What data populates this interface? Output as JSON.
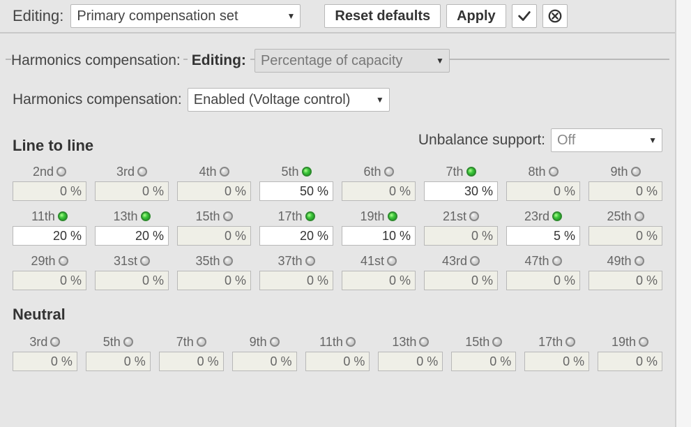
{
  "topbar": {
    "editing_label": "Editing:",
    "set_select": "Primary compensation set",
    "reset": "Reset defaults",
    "apply": "Apply"
  },
  "fieldset": {
    "title": "Harmonics compensation:",
    "editing_label": "Editing:",
    "editing_select": "Percentage of capacity"
  },
  "harm_comp": {
    "label": "Harmonics compensation:",
    "value": "Enabled (Voltage control)"
  },
  "line_to_line": {
    "title": "Line to line",
    "unbalance_label": "Unbalance support:",
    "unbalance_value": "Off",
    "items": [
      {
        "label": "2nd",
        "on": false,
        "value": "0 %"
      },
      {
        "label": "3rd",
        "on": false,
        "value": "0 %"
      },
      {
        "label": "4th",
        "on": false,
        "value": "0 %"
      },
      {
        "label": "5th",
        "on": true,
        "value": "50 %"
      },
      {
        "label": "6th",
        "on": false,
        "value": "0 %"
      },
      {
        "label": "7th",
        "on": true,
        "value": "30 %"
      },
      {
        "label": "8th",
        "on": false,
        "value": "0 %"
      },
      {
        "label": "9th",
        "on": false,
        "value": "0 %"
      },
      {
        "label": "11th",
        "on": true,
        "value": "20 %"
      },
      {
        "label": "13th",
        "on": true,
        "value": "20 %"
      },
      {
        "label": "15th",
        "on": false,
        "value": "0 %"
      },
      {
        "label": "17th",
        "on": true,
        "value": "20 %"
      },
      {
        "label": "19th",
        "on": true,
        "value": "10 %"
      },
      {
        "label": "21st",
        "on": false,
        "value": "0 %"
      },
      {
        "label": "23rd",
        "on": true,
        "value": "5 %"
      },
      {
        "label": "25th",
        "on": false,
        "value": "0 %"
      },
      {
        "label": "29th",
        "on": false,
        "value": "0 %"
      },
      {
        "label": "31st",
        "on": false,
        "value": "0 %"
      },
      {
        "label": "35th",
        "on": false,
        "value": "0 %"
      },
      {
        "label": "37th",
        "on": false,
        "value": "0 %"
      },
      {
        "label": "41st",
        "on": false,
        "value": "0 %"
      },
      {
        "label": "43rd",
        "on": false,
        "value": "0 %"
      },
      {
        "label": "47th",
        "on": false,
        "value": "0 %"
      },
      {
        "label": "49th",
        "on": false,
        "value": "0 %"
      }
    ]
  },
  "neutral": {
    "title": "Neutral",
    "items": [
      {
        "label": "3rd",
        "on": false,
        "value": "0 %"
      },
      {
        "label": "5th",
        "on": false,
        "value": "0 %"
      },
      {
        "label": "7th",
        "on": false,
        "value": "0 %"
      },
      {
        "label": "9th",
        "on": false,
        "value": "0 %"
      },
      {
        "label": "11th",
        "on": false,
        "value": "0 %"
      },
      {
        "label": "13th",
        "on": false,
        "value": "0 %"
      },
      {
        "label": "15th",
        "on": false,
        "value": "0 %"
      },
      {
        "label": "17th",
        "on": false,
        "value": "0 %"
      },
      {
        "label": "19th",
        "on": false,
        "value": "0 %"
      }
    ]
  }
}
